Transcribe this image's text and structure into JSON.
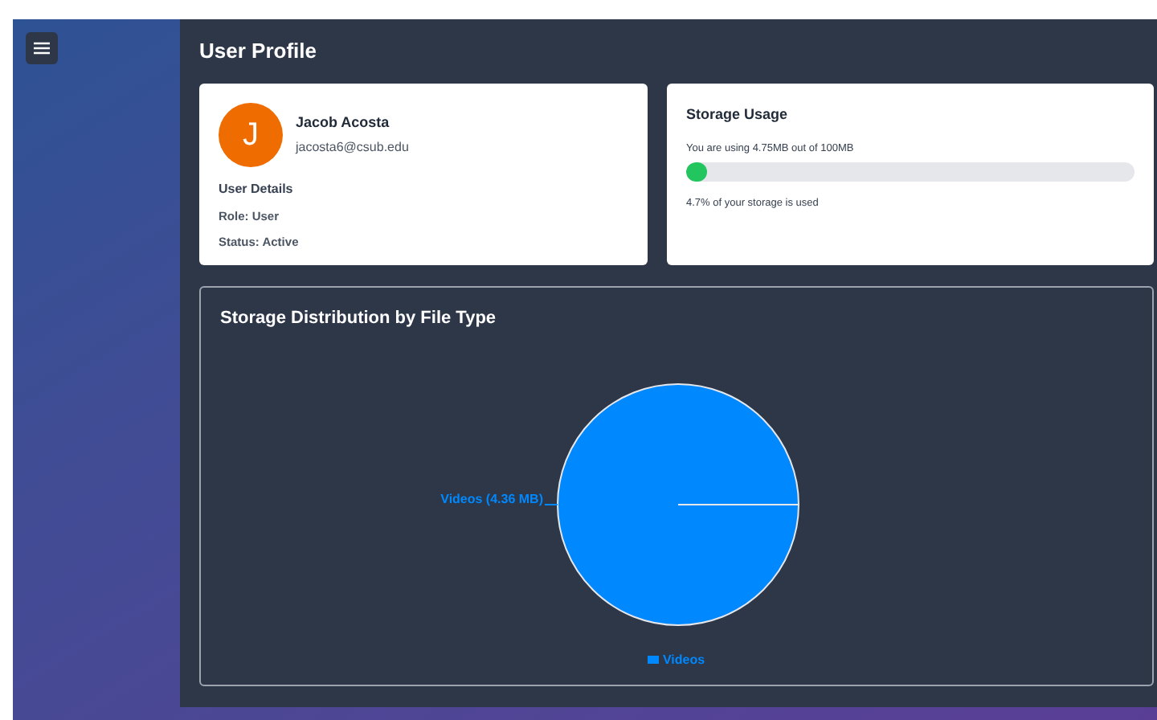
{
  "page_title": "User Profile",
  "profile": {
    "initial": "J",
    "name": "Jacob Acosta",
    "email": "jacosta6@csub.edu",
    "details_heading": "User Details",
    "role": "Role: User",
    "status": "Status: Active"
  },
  "storage": {
    "title": "Storage Usage",
    "usage_text": "You are using 4.75MB out of 100MB",
    "level": 0.047,
    "percent_text": "4.7% of your storage is used"
  },
  "distribution": {
    "title": "Storage Distribution by File Type",
    "chart_data": {
      "type": "pie",
      "categories": [
        "Videos"
      ],
      "series": [
        {
          "color": "#0088fe",
          "values": [
            100
          ]
        }
      ],
      "value_labels": [
        "Videos (4.36 MB)"
      ]
    }
  }
}
